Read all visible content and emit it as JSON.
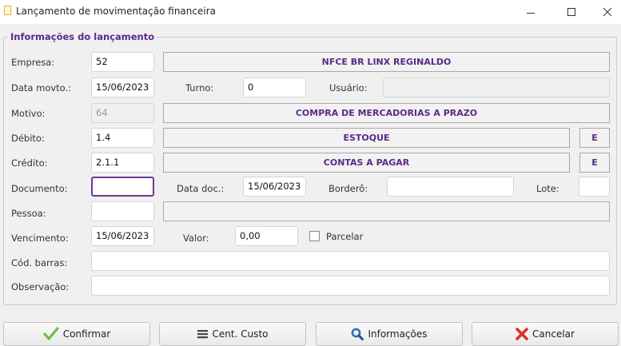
{
  "window": {
    "title": "Lançamento de movimentação financeira"
  },
  "group": {
    "title": "Informações do lançamento"
  },
  "form": {
    "empresa_label": "Empresa:",
    "empresa_value": "52",
    "empresa_name": "NFCE BR LINX REGINALDO",
    "data_movto_label": "Data movto.:",
    "data_movto_value": "15/06/2023",
    "turno_label": "Turno:",
    "turno_value": "0",
    "usuario_label": "Usuário:",
    "usuario_value": "",
    "motivo_label": "Motivo:",
    "motivo_value": "64",
    "motivo_name": "COMPRA DE MERCADORIAS A PRAZO",
    "debito_label": "Débito:",
    "debito_value": "1.4",
    "debito_name": "ESTOQUE",
    "debito_button": "E",
    "credito_label": "Crédito:",
    "credito_value": "2.1.1",
    "credito_name": "CONTAS A PAGAR",
    "credito_button": "E",
    "documento_label": "Documento:",
    "documento_value": "",
    "data_doc_label": "Data doc.:",
    "data_doc_value": "15/06/2023",
    "bordero_label": "Borderô:",
    "bordero_value": "",
    "lote_label": "Lote:",
    "lote_value": "",
    "pessoa_label": "Pessoa:",
    "pessoa_value": "",
    "pessoa_name": "",
    "vencimento_label": "Vencimento:",
    "vencimento_value": "15/06/2023",
    "valor_label": "Valor:",
    "valor_value": "0,00",
    "parcelar_label": "Parcelar",
    "cod_barras_label": "Cód. barras:",
    "cod_barras_value": "",
    "observacao_label": "Observação:",
    "observacao_value": ""
  },
  "buttons": {
    "confirmar": "Confirmar",
    "cent_custo": "Cent. Custo",
    "informacoes": "Informações",
    "cancelar": "Cancelar"
  },
  "colors": {
    "accent_purple": "#5b2a86",
    "confirm_green": "#6cc04a",
    "info_blue": "#2f6fb8",
    "cancel_red": "#d9322a"
  },
  "icons": {
    "confirmar": "check-icon",
    "cent_custo": "list-icon",
    "informacoes": "magnifier-icon",
    "cancelar": "cross-icon"
  }
}
